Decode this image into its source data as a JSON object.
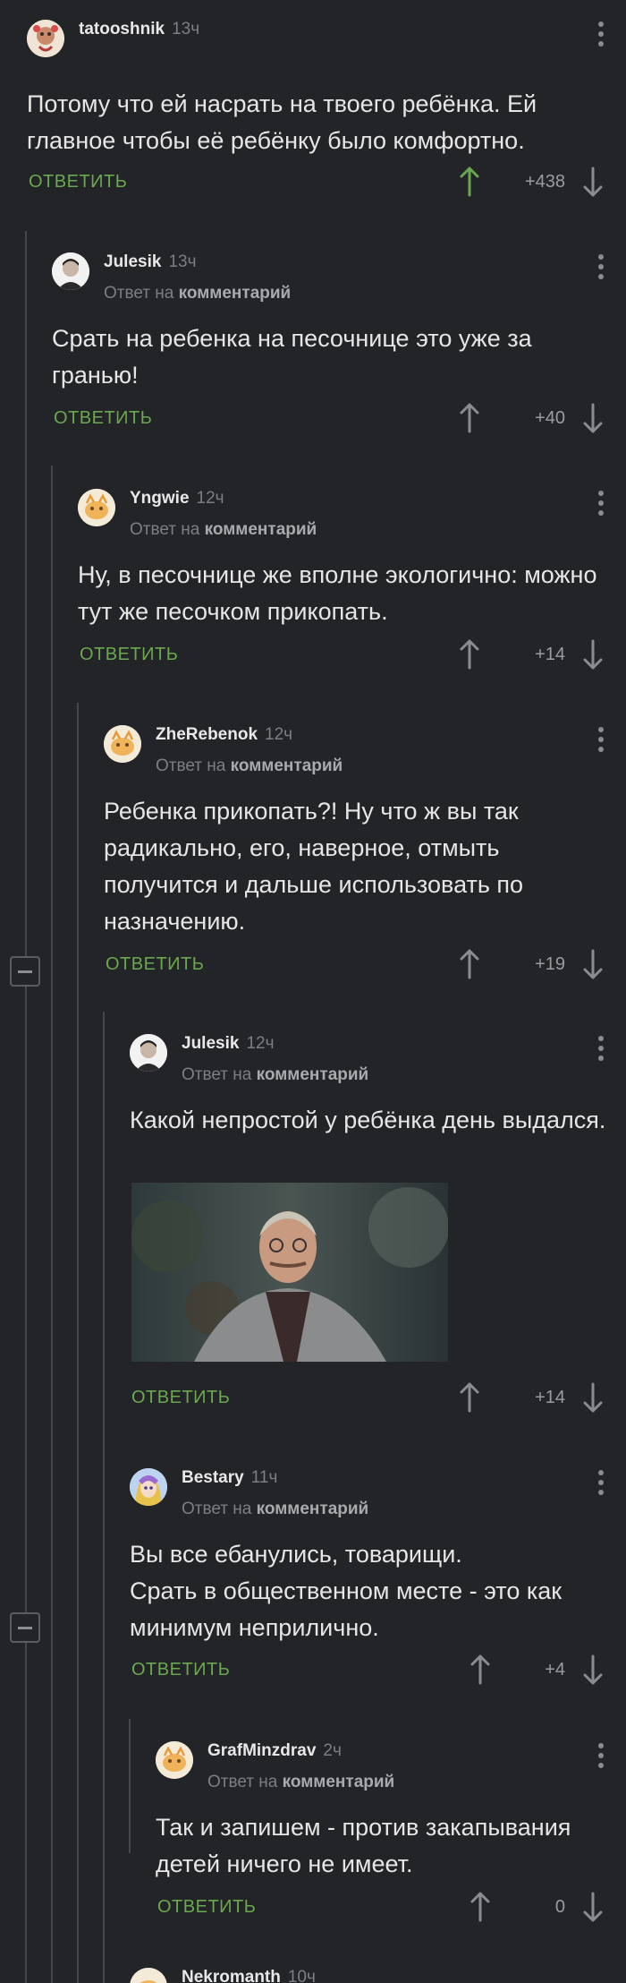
{
  "comments": [
    {
      "user": "tatooshnik",
      "time": "13ч",
      "reply_prefix": "",
      "reply_target": "",
      "text": "Потому что ей насрать на твоего ребёнка. Ей главное чтобы её ребёнку было комфортно.",
      "reply_label": "ОТВЕТИТЬ",
      "score": "+438",
      "avatar": "tatoo-avatar",
      "upvoted": true
    },
    {
      "user": "Julesik",
      "time": "13ч",
      "reply_prefix": "Ответ на",
      "reply_target": "комментарий",
      "text": "Срать на ребенка на песочнице это уже за гранью!",
      "reply_label": "ОТВЕТИТЬ",
      "score": "+40",
      "avatar": "man-avatar"
    },
    {
      "user": "Yngwie",
      "time": "12ч",
      "reply_prefix": "Ответ на",
      "reply_target": "комментарий",
      "text": "Ну, в песочнице же вполне экологично: можно тут же песочком прикопать.",
      "reply_label": "ОТВЕТИТЬ",
      "score": "+14",
      "avatar": "default-avatar"
    },
    {
      "user": "ZheRebenok",
      "time": "12ч",
      "reply_prefix": "Ответ на",
      "reply_target": "комментарий",
      "text": "Ребенка прикопать?! Ну что ж вы так радикально, его, наверное, отмыть получится и дальше использовать по назначению.",
      "reply_label": "ОТВЕТИТЬ",
      "score": "+19",
      "avatar": "default-avatar"
    },
    {
      "user": "Julesik",
      "time": "12ч",
      "reply_prefix": "Ответ на",
      "reply_target": "комментарий",
      "text": "Какой непростой у ребёнка день выдался.",
      "reply_label": "ОТВЕТИТЬ",
      "score": "+14",
      "avatar": "man-avatar",
      "image": "smiling-man-photo"
    },
    {
      "user": "Bestary",
      "time": "11ч",
      "reply_prefix": "Ответ на",
      "reply_target": "комментарий",
      "text": "Вы все ебанулись, товарищи.\nСрать в общественном месте - это как минимум неприлично.",
      "reply_label": "ОТВЕТИТЬ",
      "score": "+4",
      "avatar": "anime-avatar"
    },
    {
      "user": "GrafMinzdrav",
      "time": "2ч",
      "reply_prefix": "Ответ на",
      "reply_target": "комментарий",
      "text": "Так и запишем - против закапывания детей ничего не имеет.",
      "reply_label": "ОТВЕТИТЬ",
      "score": "0",
      "avatar": "default-avatar"
    },
    {
      "user": "Nekromanth",
      "time": "10ч",
      "reply_prefix": "",
      "reply_target": "",
      "text": "",
      "reply_label": "",
      "score": "",
      "avatar": "default-avatar"
    }
  ],
  "colors": {
    "background": "#232427",
    "reply": "#6aa84f",
    "upvote_active": "#6aa84f",
    "text": "#e6e6e6",
    "muted": "#7c7e82"
  }
}
